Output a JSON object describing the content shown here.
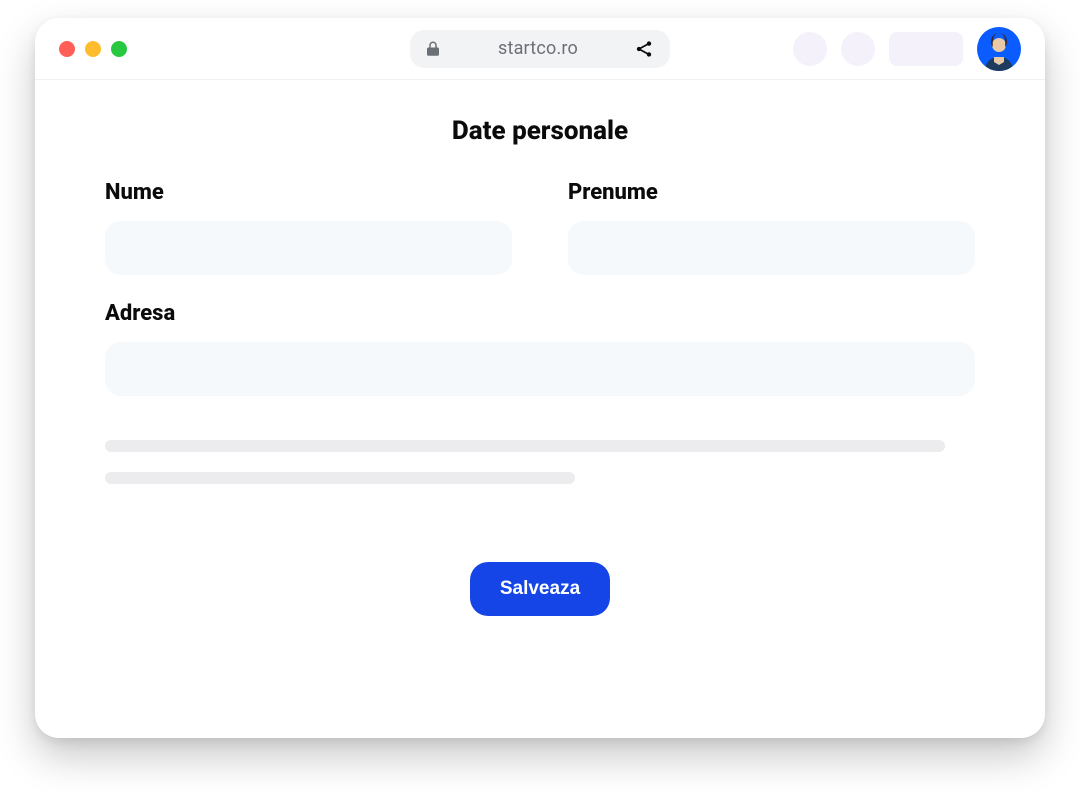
{
  "browser": {
    "host": "startco.ro"
  },
  "page": {
    "title": "Date personale",
    "fields": {
      "last_name": {
        "label": "Nume",
        "value": ""
      },
      "first_name": {
        "label": "Prenume",
        "value": ""
      },
      "address": {
        "label": "Adresa",
        "value": ""
      }
    },
    "save_label": "Salveaza"
  },
  "colors": {
    "primary": "#1545e6",
    "input_bg": "#f6f9fc",
    "skeleton": "#ececee"
  }
}
